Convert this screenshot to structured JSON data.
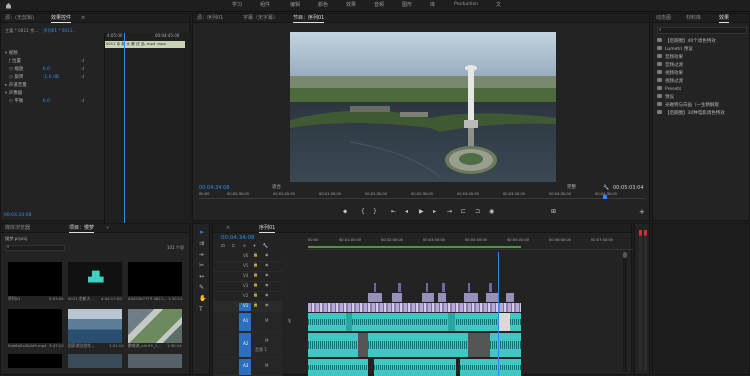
{
  "menu": {
    "items": [
      "学习",
      "组件",
      "编辑",
      "颜色",
      "效果",
      "音频",
      "图形",
      "库",
      "Production",
      "文"
    ]
  },
  "effect_controls": {
    "tab_source": "源：(无剪辑)",
    "tab_effects": "效果控件",
    "tab_mixer": "≡",
    "header_master": "主要 * 0011 京...",
    "header_seq": "序列01 * 0011...",
    "timecode_start": "4:05:00",
    "timecode_end": "00:04:45:00",
    "clip_label": "0011 京 新 大 赛 试 品 .mp4 .mpa",
    "section_video": "视频",
    "section_audio": "音频",
    "motion": "位置",
    "scale_label": "缩放",
    "scale_value": "0.0",
    "rotate_label": "旋转",
    "rotate_value": "-1.0 dB",
    "volume_section": "声道音量",
    "panner_section": "声像器",
    "pan_label": "平衡",
    "pan_value": "0.0",
    "bottom_time": "00:04:34:08"
  },
  "program": {
    "tab_source": "源：序列01",
    "tab_caption": "字幕（无字幕）",
    "tab_program": "节目：序列01",
    "timecode": "00:04:34:08",
    "fit": "适合",
    "quality": "完整",
    "duration": "00:05:03:04",
    "ruler": [
      "00:00",
      "00:00:30:00",
      "00:01:00:00",
      "00:01:30:00",
      "00:02:00:00",
      "00:02:30:00",
      "00:03:00:00",
      "00:03:30:00",
      "00:04:00:00",
      "00:04:30:00"
    ]
  },
  "project": {
    "tab_media": "媒体浏览器",
    "tab_project": "项目：慢梦",
    "tab_more": "»",
    "project_file": "慢梦.prproj",
    "item_count": "101 个项",
    "items": [
      {
        "name": "序列01",
        "dur": "5:03:04",
        "type": "black"
      },
      {
        "name": "0011 京新大...",
        "dur": "4:45:17:00",
        "type": "audio"
      },
      {
        "name": "A0423e7773 4611...",
        "dur": "1:30:12",
        "type": "black"
      },
      {
        "name": "5da6d2a2b0d9.mp4",
        "dur": "3:47:10",
        "type": "black"
      },
      {
        "name": "国家湖泊游览...",
        "dur": "1:01:10",
        "type": "water"
      },
      {
        "name": "鹏城湖_a0c55_1...",
        "dur": "1:30:14",
        "type": "road"
      }
    ]
  },
  "timeline": {
    "tab_close": "×",
    "tab_sequence": "序列01",
    "timecode": "00:04:34:08",
    "ruler": [
      "00:00",
      "00:01:00:00",
      "00:02:00:00",
      "00:03:00:00",
      "00:04:00:00",
      "00:05:00:00",
      "00:06:00:00",
      "00:07:00:00"
    ],
    "video_tracks": [
      "V6",
      "V5",
      "V4",
      "V3",
      "V2",
      "V1"
    ],
    "audio_tracks": [
      "A1",
      "A2",
      "A3",
      "A4"
    ],
    "audio_names": [
      "M",
      "M",
      "音频 1",
      "M"
    ],
    "meter_db": [
      "0",
      "-6",
      "-12",
      "-18",
      "-24",
      "-30",
      "-36",
      "-42",
      "-48",
      "-54"
    ]
  },
  "effects_panel": {
    "tab_dynamic": "动态图",
    "tab_lib": "材料库",
    "tab_effects": "效果",
    "search_placeholder": "",
    "items": [
      "【后期圈】40个调色特效",
      "Lumetri 预设",
      "音频效果",
      "音频过渡",
      "视频效果",
      "视频过渡",
      "Presets",
      "预设",
      "光磁特与白画（一生精解版",
      "【后期圈】30种电影调色特效"
    ]
  }
}
